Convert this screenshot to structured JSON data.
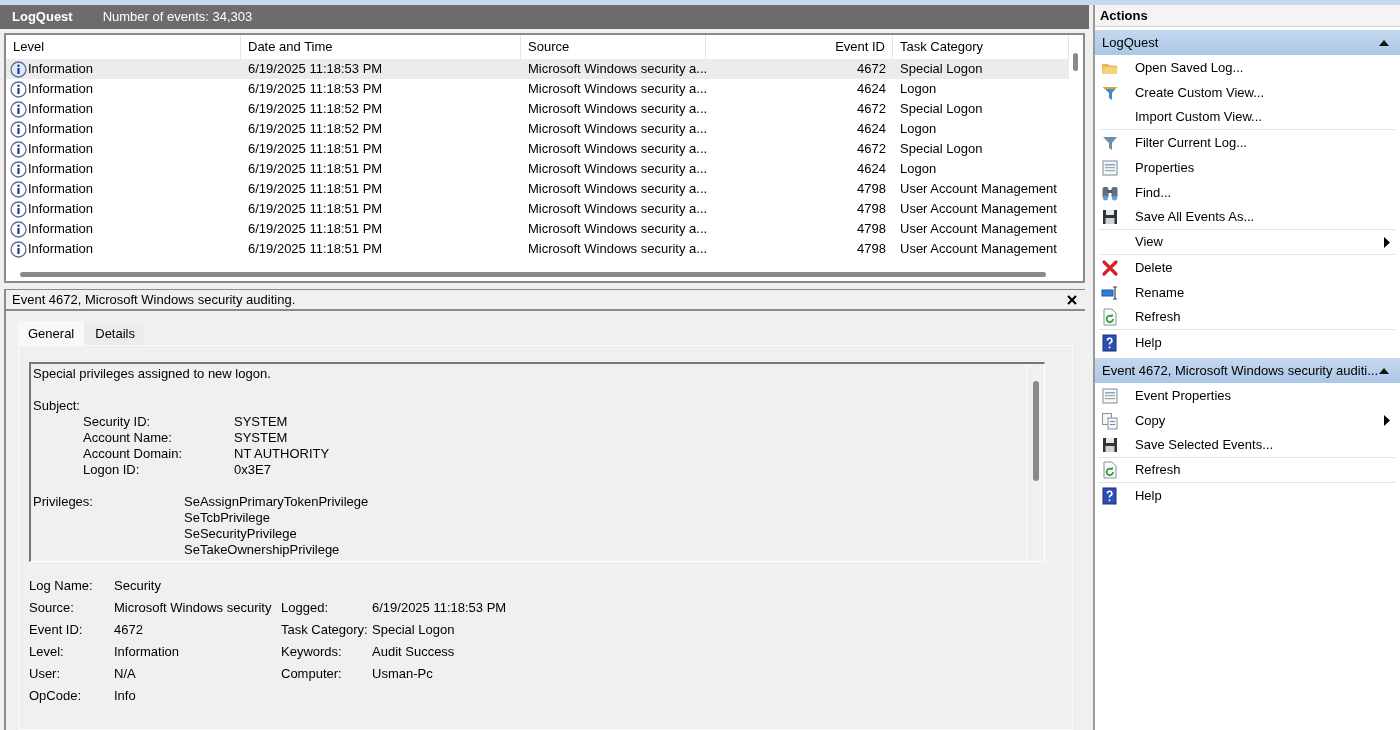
{
  "header": {
    "title": "LogQuest",
    "count": "Number of events: 34,303"
  },
  "table": {
    "columns": [
      "Level",
      "Date and Time",
      "Source",
      "Event ID",
      "Task Category"
    ],
    "rows": [
      {
        "level": "Information",
        "date": "6/19/2025 11:18:53 PM",
        "source": "Microsoft Windows security a...",
        "event_id": "4672",
        "category": "Special Logon",
        "selected": true
      },
      {
        "level": "Information",
        "date": "6/19/2025 11:18:53 PM",
        "source": "Microsoft Windows security a...",
        "event_id": "4624",
        "category": "Logon",
        "selected": false
      },
      {
        "level": "Information",
        "date": "6/19/2025 11:18:52 PM",
        "source": "Microsoft Windows security a...",
        "event_id": "4672",
        "category": "Special Logon",
        "selected": false
      },
      {
        "level": "Information",
        "date": "6/19/2025 11:18:52 PM",
        "source": "Microsoft Windows security a...",
        "event_id": "4624",
        "category": "Logon",
        "selected": false
      },
      {
        "level": "Information",
        "date": "6/19/2025 11:18:51 PM",
        "source": "Microsoft Windows security a...",
        "event_id": "4672",
        "category": "Special Logon",
        "selected": false
      },
      {
        "level": "Information",
        "date": "6/19/2025 11:18:51 PM",
        "source": "Microsoft Windows security a...",
        "event_id": "4624",
        "category": "Logon",
        "selected": false
      },
      {
        "level": "Information",
        "date": "6/19/2025 11:18:51 PM",
        "source": "Microsoft Windows security a...",
        "event_id": "4798",
        "category": "User Account Management",
        "selected": false
      },
      {
        "level": "Information",
        "date": "6/19/2025 11:18:51 PM",
        "source": "Microsoft Windows security a...",
        "event_id": "4798",
        "category": "User Account Management",
        "selected": false
      },
      {
        "level": "Information",
        "date": "6/19/2025 11:18:51 PM",
        "source": "Microsoft Windows security a...",
        "event_id": "4798",
        "category": "User Account Management",
        "selected": false
      },
      {
        "level": "Information",
        "date": "6/19/2025 11:18:51 PM",
        "source": "Microsoft Windows security a...",
        "event_id": "4798",
        "category": "User Account Management",
        "selected": false
      }
    ]
  },
  "detail": {
    "title": "Event 4672, Microsoft Windows security auditing.",
    "tabs": [
      {
        "label": "General",
        "selected": true
      },
      {
        "label": "Details",
        "selected": false
      }
    ],
    "description": {
      "intro": "Special privileges assigned to new logon.",
      "subject": {
        "heading": "Subject:",
        "fields": [
          {
            "label": "Security ID:",
            "value": "SYSTEM"
          },
          {
            "label": "Account Name:",
            "value": "SYSTEM"
          },
          {
            "label": "Account Domain:",
            "value": "NT AUTHORITY"
          },
          {
            "label": "Logon ID:",
            "value": "0x3E7"
          }
        ]
      },
      "privileges": {
        "heading": "Privileges:",
        "values": [
          "SeAssignPrimaryTokenPrivilege",
          "SeTcbPrivilege",
          "SeSecurityPrivilege",
          "SeTakeOwnershipPrivilege"
        ]
      }
    },
    "properties_left": [
      {
        "label": "Log Name:",
        "value": "Security"
      },
      {
        "label": "Source:",
        "value": "Microsoft Windows security"
      },
      {
        "label": "Event ID:",
        "value": "4672"
      },
      {
        "label": "Level:",
        "value": "Information"
      },
      {
        "label": "User:",
        "value": "N/A"
      },
      {
        "label": "OpCode:",
        "value": "Info"
      }
    ],
    "properties_right": [
      {
        "label": "Logged:",
        "value": "6/19/2025 11:18:53 PM"
      },
      {
        "label": "Task Category:",
        "value": "Special Logon"
      },
      {
        "label": "Keywords:",
        "value": "Audit Success"
      },
      {
        "label": "Computer:",
        "value": "Usman-Pc"
      }
    ]
  },
  "actions": {
    "title": "Actions",
    "sections": [
      {
        "title": "LogQuest",
        "expanded": true,
        "items": [
          {
            "label": "Open Saved Log...",
            "kind": "folder",
            "submenu": false,
            "divider": false
          },
          {
            "label": "Create Custom View...",
            "kind": "funnel-star",
            "submenu": false,
            "divider": false
          },
          {
            "label": "Import Custom View...",
            "kind": "none",
            "submenu": false,
            "divider": true
          },
          {
            "label": "Filter Current Log...",
            "kind": "funnel",
            "submenu": false,
            "divider": false
          },
          {
            "label": "Properties",
            "kind": "properties",
            "submenu": false,
            "divider": false
          },
          {
            "label": "Find...",
            "kind": "find",
            "submenu": false,
            "divider": false
          },
          {
            "label": "Save All Events As...",
            "kind": "save",
            "submenu": false,
            "divider": true
          },
          {
            "label": "View",
            "kind": "none",
            "submenu": true,
            "divider": true
          },
          {
            "label": "Delete",
            "kind": "delete",
            "submenu": false,
            "divider": false
          },
          {
            "label": "Rename",
            "kind": "rename",
            "submenu": false,
            "divider": false
          },
          {
            "label": "Refresh",
            "kind": "refresh",
            "submenu": false,
            "divider": true
          },
          {
            "label": "Help",
            "kind": "help",
            "submenu": false,
            "divider": false
          }
        ]
      },
      {
        "title": "Event 4672, Microsoft Windows security auditi...",
        "expanded": true,
        "items": [
          {
            "label": "Event Properties",
            "kind": "properties",
            "submenu": false,
            "divider": false
          },
          {
            "label": "Copy",
            "kind": "copy",
            "submenu": true,
            "divider": false
          },
          {
            "label": "Save Selected Events...",
            "kind": "save",
            "submenu": false,
            "divider": true
          },
          {
            "label": "Refresh",
            "kind": "refresh",
            "submenu": false,
            "divider": true
          },
          {
            "label": "Help",
            "kind": "help",
            "submenu": false,
            "divider": false
          }
        ]
      }
    ]
  }
}
